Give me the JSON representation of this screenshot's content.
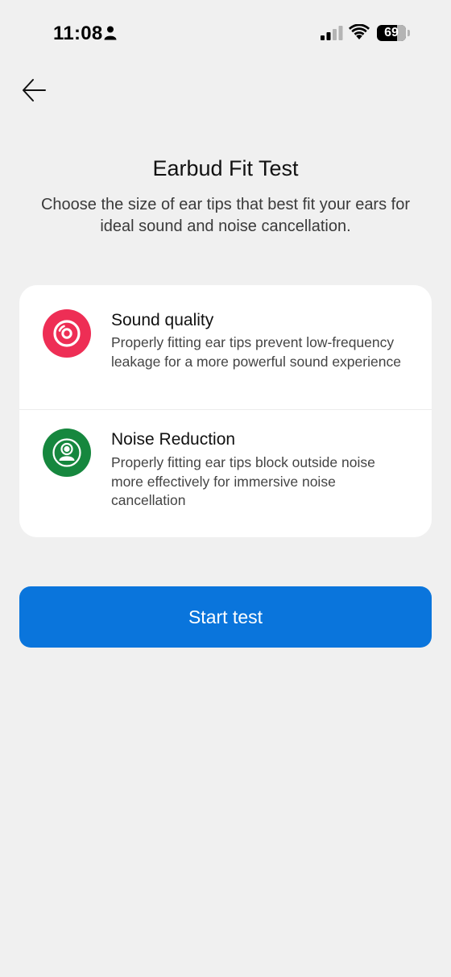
{
  "status_bar": {
    "time": "11:08",
    "battery_level": "69",
    "icons": [
      "person-icon",
      "signal-icon",
      "wifi-icon",
      "battery-icon"
    ]
  },
  "nav": {
    "back_icon": "arrow-left-icon"
  },
  "header": {
    "title": "Earbud Fit Test",
    "subtitle": "Choose the size of ear tips that best fit your ears for ideal sound and noise cancellation."
  },
  "features": [
    {
      "icon": "disc-icon",
      "icon_color": "#ee2e55",
      "title": "Sound quality",
      "description": "Properly fitting ear tips prevent low-frequency leakage for a more powerful sound experience"
    },
    {
      "icon": "person-circle-icon",
      "icon_color": "#16873e",
      "title": "Noise Reduction",
      "description": "Properly fitting ear tips block outside noise more effectively for immersive noise cancellation"
    }
  ],
  "actions": {
    "start_label": "Start test",
    "accent_color": "#0a75dc"
  }
}
